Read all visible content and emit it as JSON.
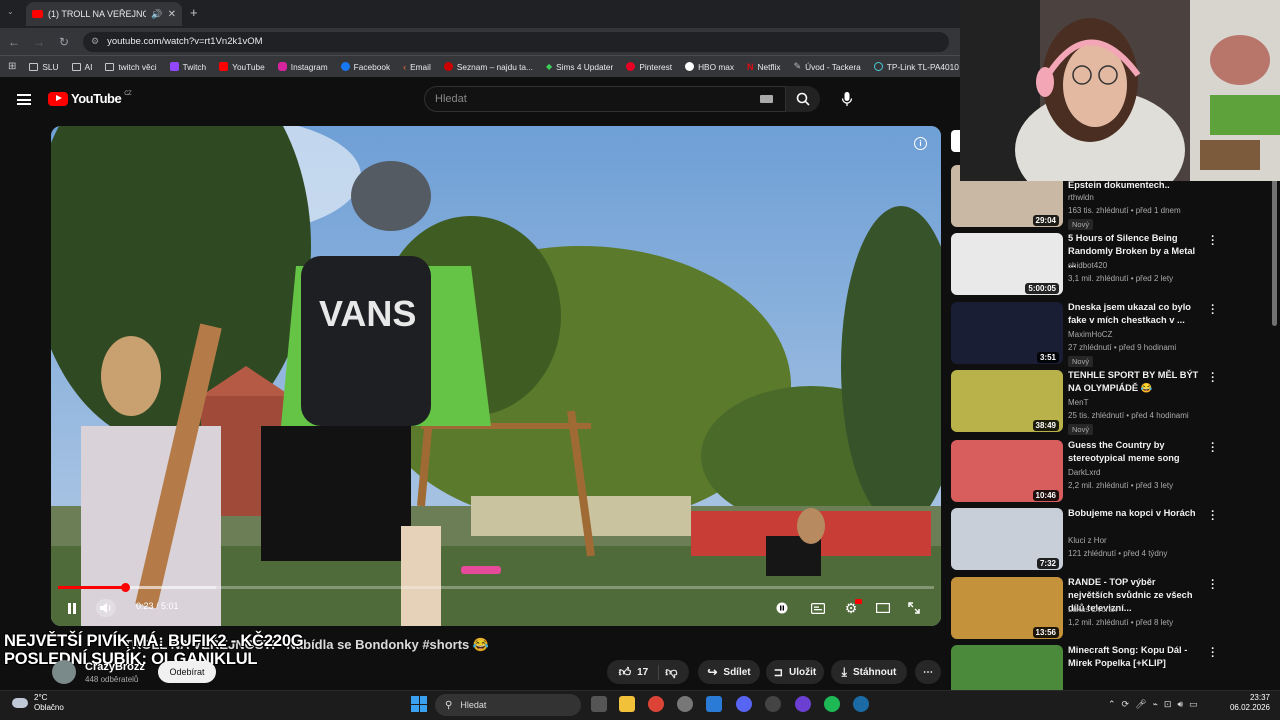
{
  "browser": {
    "tab_title": "(1) TROLL NA VEŘEJNOSTI",
    "url": "youtube.com/watch?v=rt1Vn2k1vOM",
    "bookmarks": [
      "SLU",
      "AI",
      "twitch věci",
      "Twitch",
      "YouTube",
      "Instagram",
      "Facebook",
      "Email",
      "Seznam – najdu ta...",
      "Sims 4 Updater",
      "Pinterest",
      "HBO max",
      "Netflix",
      "Úvod - Tackera",
      "TP-Link TL-PA4010"
    ]
  },
  "youtube": {
    "logo": "YouTube",
    "logo_region": "CZ",
    "search_placeholder": "Hledat"
  },
  "player": {
    "time": "0:23 / 5:01",
    "progress": 0.076,
    "buffered": 0.18
  },
  "video": {
    "overlay_line1": "NEJVĚTŠÍ PIVÍK MÁ: BUFIK2 - KČ220G",
    "overlay_line2": "POSLEDNÍ SUBÍK: OLGANIKLUL",
    "title": "TROLL NA VEŘEJNOSTI - Nabídla se Bondonky #shorts 😂",
    "channel": "CrazyBrozz",
    "subscribers": "448 odběratelů",
    "subscribe_label": "Odebírat",
    "likes": "17",
    "share_label": "Sdílet",
    "save_label": "Uložit",
    "download_label": "Stáhnout"
  },
  "recommendations": [
    {
      "title": "Epstein dokumentech..",
      "channel": "rthwldn",
      "meta": "163 tis. zhlédnutí • před 1 dnem",
      "badge": "Nový",
      "duration": "29:04",
      "color": "#c9b9a4"
    },
    {
      "title": "5 Hours of Silence Being Randomly Broken by a Metal ...",
      "channel": "shidbot420",
      "meta": "3,1 mil. zhlédnutí • před 2 lety",
      "badge": "",
      "duration": "5:00:05",
      "color": "#e9e9e9"
    },
    {
      "title": "Dneska jsem ukazal co bylo fake v mích chestkach v ...",
      "channel": "MaximHoCZ",
      "meta": "27 zhlédnutí • před 9 hodinami",
      "badge": "Nový",
      "duration": "3:51",
      "color": "#1a1e34"
    },
    {
      "title": "TENHLE SPORT BY MĚL BÝT NA OLYMPIÁDĚ 😂",
      "channel": "MenT",
      "meta": "25 tis. zhlédnutí • před 4 hodinami",
      "badge": "Nový",
      "duration": "38:49",
      "color": "#b9b24a"
    },
    {
      "title": "Guess the Country by stereotypical meme song",
      "channel": "DarkLxrd",
      "meta": "2,2 mil. zhlédnutí • před 3 lety",
      "badge": "",
      "duration": "10:46",
      "color": "#d85d5d"
    },
    {
      "title": "Bobujeme na kopci v Horách",
      "channel": "Kluci z Hor",
      "meta": "121 zhlédnutí • před 4 týdny",
      "badge": "",
      "duration": "7:32",
      "color": "#c8cfd8"
    },
    {
      "title": "RANDE - TOP výběr největších svůdnic ze všech dílů televizní...",
      "channel": "Lukas Dvorak",
      "meta": "1,2 mil. zhlédnutí • před 8 lety",
      "badge": "",
      "duration": "13:56",
      "color": "#c4923a"
    },
    {
      "title": "Minecraft Song: Kopu Dál - Mirek Popelka [+KLIP]",
      "channel": "",
      "meta": "",
      "badge": "",
      "duration": "",
      "color": "#4a8a3a"
    }
  ],
  "taskbar": {
    "temperature": "2°C",
    "weather": "Oblačno",
    "search_placeholder": "Hledat",
    "time": "23:37",
    "date": "06.02.2026"
  }
}
